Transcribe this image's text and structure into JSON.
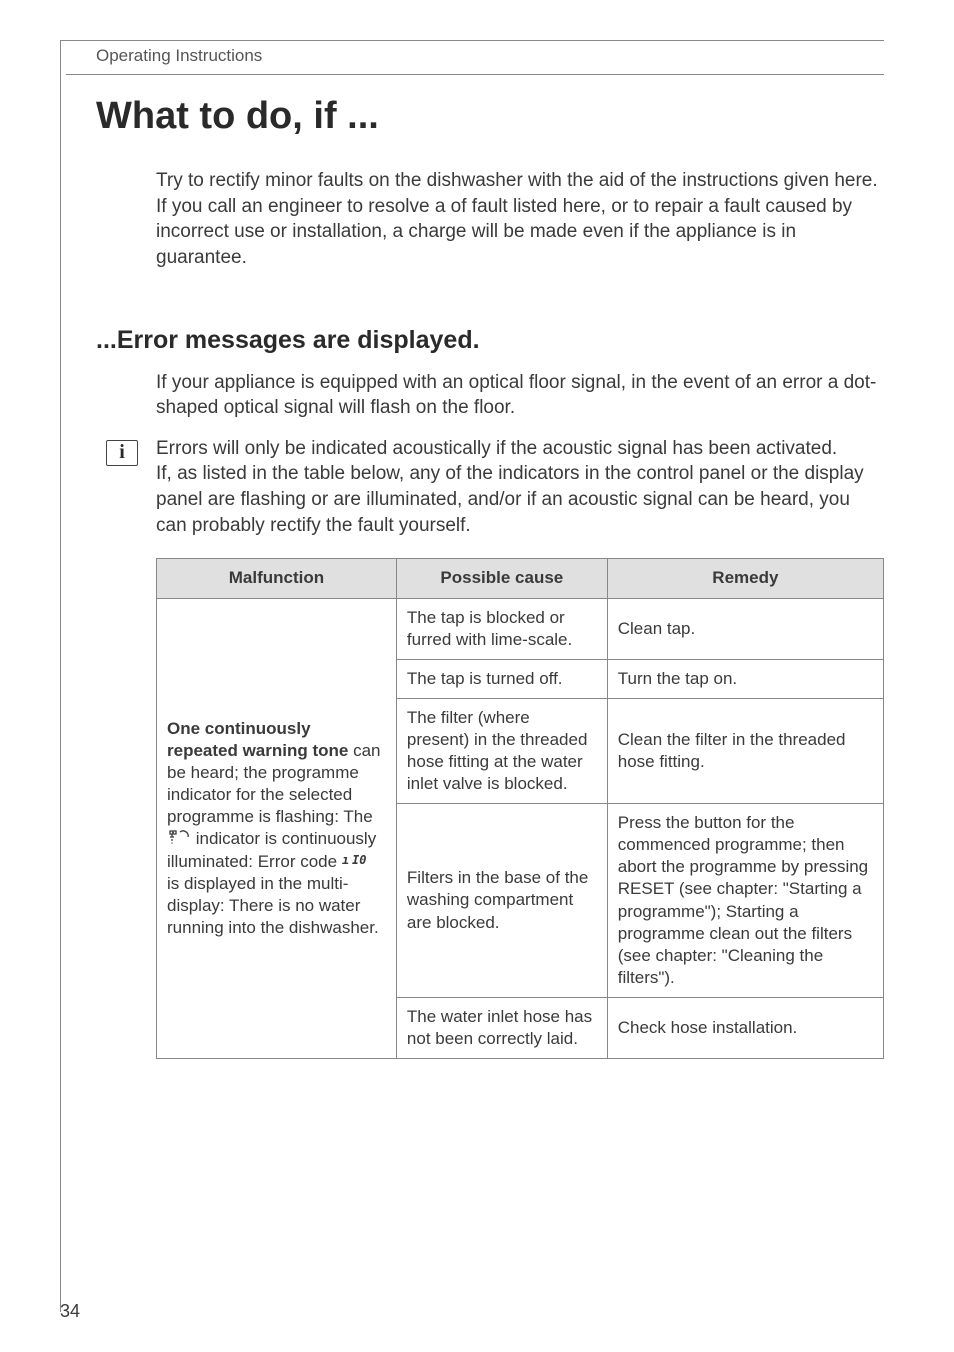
{
  "page": {
    "header": "Operating Instructions",
    "title": "What to do, if ...",
    "intro": "Try to rectify minor faults on the dishwasher with the aid of the instructions given here. If you call an engineer to resolve a of fault listed here, or to repair a fault caused by incorrect use or installation, a charge will be made even if the appliance is in guarantee.",
    "section_title": "...Error messages are displayed.",
    "section_p1": "If your appliance is equipped with an optical floor signal, in the event of an error a dot-shaped optical signal will flash on the floor.",
    "info_p1": "Errors will only be indicated acoustically if the acoustic signal has been activated.",
    "info_p2": "If, as listed in the table below, any of the indicators in the control panel or the display panel are flashing or are illuminated, and/or if an acoustic signal can be heard, you can probably rectify the fault yourself.",
    "page_number": "34"
  },
  "table": {
    "headers": {
      "malfunction": "Malfunction",
      "cause": "Possible cause",
      "remedy": "Remedy"
    },
    "malfunction": {
      "bold1": "One continuously repeated warning tone",
      "text1": " can be heard; the programme indicator for the selected programme is flashing: The ",
      "text2": " indicator is continuously illuminated: Error code ",
      "text3": " is displayed in the multi-display: There is no water running into the dishwasher."
    },
    "rows": [
      {
        "cause": "The tap is blocked or furred with lime-scale.",
        "remedy": "Clean tap."
      },
      {
        "cause": "The tap is turned off.",
        "remedy": "Turn the tap on."
      },
      {
        "cause": "The filter (where present) in the threaded hose fitting at the water inlet valve is blocked.",
        "remedy": "Clean the filter in the threaded hose fitting."
      },
      {
        "cause": "Filters in the base of the washing compartment are blocked.",
        "remedy": "Press the button for the commenced programme; then abort the programme by pressing RESET (see chapter: \"Starting a programme\"); Starting a programme clean out the filters (see chapter: \"Cleaning the filters\")."
      },
      {
        "cause": "The water inlet hose has not been correctly laid.",
        "remedy": "Check hose installation."
      }
    ]
  }
}
